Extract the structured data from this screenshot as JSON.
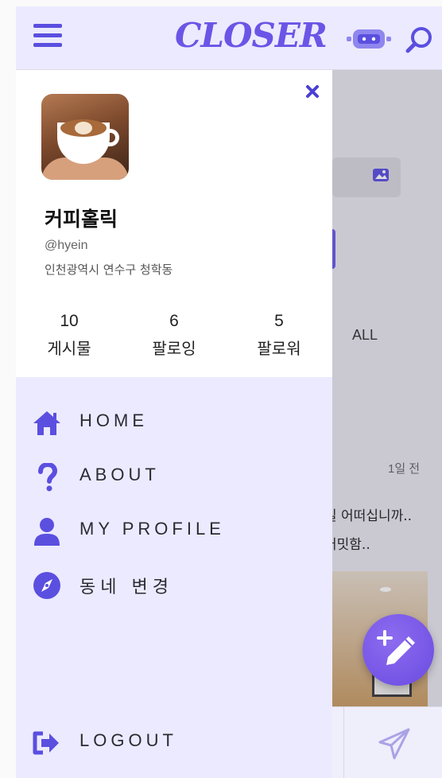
{
  "header": {
    "logo_text": "CLOSER",
    "icons": [
      "menu-icon",
      "robot-icon",
      "search-icon"
    ]
  },
  "background": {
    "filter_label": "ALL",
    "post_time": "1일 전",
    "post_text_line1": "실 어떠십니까..",
    "post_text_line2": "커밋함.."
  },
  "drawer": {
    "profile": {
      "name": "커피홀릭",
      "handle": "@hyein",
      "location": "인천광역시 연수구 청학동"
    },
    "stats": [
      {
        "value": "10",
        "label": "게시물"
      },
      {
        "value": "6",
        "label": "팔로잉"
      },
      {
        "value": "5",
        "label": "팔로워"
      }
    ],
    "menu": [
      {
        "label": "HOME",
        "icon": "home-icon"
      },
      {
        "label": "ABOUT",
        "icon": "question-icon"
      },
      {
        "label": "MY PROFILE",
        "icon": "user-icon"
      },
      {
        "label": "동네 변경",
        "icon": "compass-icon"
      }
    ],
    "logout_label": "LOGOUT"
  },
  "colors": {
    "accent": "#5b4fe0",
    "drawer_bg": "#eceaff",
    "fab_bg": "#7a5ae8"
  }
}
